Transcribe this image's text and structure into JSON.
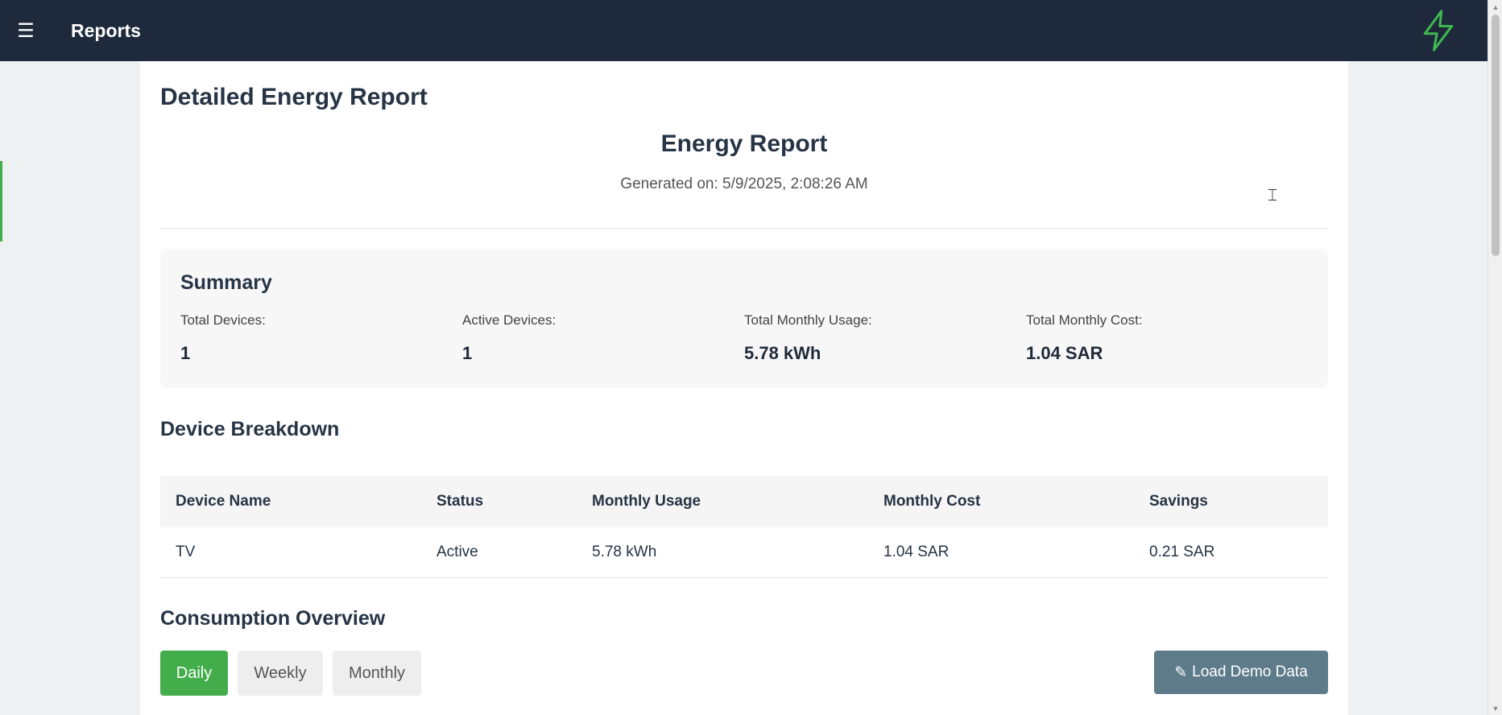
{
  "topbar": {
    "menu_icon": "hamburger-menu-icon",
    "title": "Reports",
    "logo_icon": "lightning-bolt-icon",
    "logo_color": "#3fb950"
  },
  "page": {
    "title": "Detailed Energy Report"
  },
  "report": {
    "title": "Energy Report",
    "generated": "Generated on: 5/9/2025, 2:08:26 AM"
  },
  "summary": {
    "title": "Summary",
    "items": [
      {
        "label": "Total Devices:",
        "value": "1"
      },
      {
        "label": "Active Devices:",
        "value": "1"
      },
      {
        "label": "Total Monthly Usage:",
        "value": "5.78 kWh"
      },
      {
        "label": "Total Monthly Cost:",
        "value": "1.04 SAR"
      }
    ]
  },
  "breakdown": {
    "title": "Device Breakdown",
    "columns": [
      "Device Name",
      "Status",
      "Monthly Usage",
      "Monthly Cost",
      "Savings"
    ],
    "rows": [
      [
        "TV",
        "Active",
        "5.78 kWh",
        "1.04 SAR",
        "0.21 SAR"
      ]
    ]
  },
  "overview": {
    "title": "Consumption Overview",
    "tabs": [
      {
        "label": "Daily",
        "active": true
      },
      {
        "label": "Weekly",
        "active": false
      },
      {
        "label": "Monthly",
        "active": false
      }
    ],
    "demo_button_label": "Load Demo Data",
    "demo_button_icon": "pencil-icon"
  },
  "colors": {
    "topbar_bg": "#1e293b",
    "active_tab": "#43ad4b",
    "demo_button": "#5e7b8a"
  }
}
